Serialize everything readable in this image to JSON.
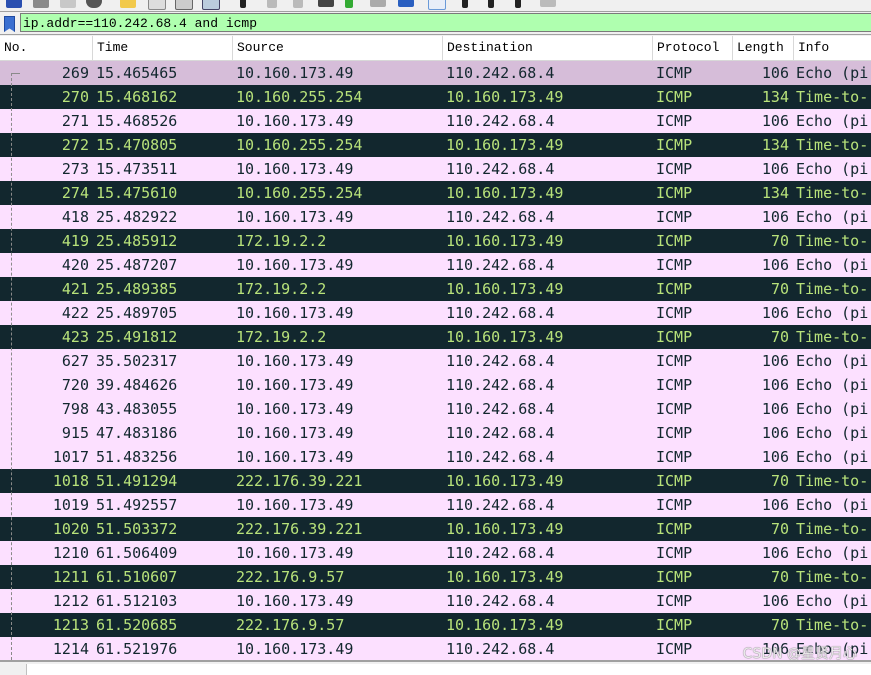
{
  "filter": {
    "value": "ip.addr==110.242.68.4 and icmp"
  },
  "columns": [
    "No.",
    "Time",
    "Source",
    "Destination",
    "Protocol",
    "Length",
    "Info"
  ],
  "rows": [
    {
      "no": "269",
      "time": "15.465465",
      "src": "10.160.173.49",
      "dst": "110.242.68.4",
      "proto": "ICMP",
      "len": "106",
      "info": "Echo (pi",
      "style": "selected"
    },
    {
      "no": "270",
      "time": "15.468162",
      "src": "10.160.255.254",
      "dst": "10.160.173.49",
      "proto": "ICMP",
      "len": "134",
      "info": "Time-to-",
      "style": "dark"
    },
    {
      "no": "271",
      "time": "15.468526",
      "src": "10.160.173.49",
      "dst": "110.242.68.4",
      "proto": "ICMP",
      "len": "106",
      "info": "Echo (pi",
      "style": "light"
    },
    {
      "no": "272",
      "time": "15.470805",
      "src": "10.160.255.254",
      "dst": "10.160.173.49",
      "proto": "ICMP",
      "len": "134",
      "info": "Time-to-",
      "style": "dark"
    },
    {
      "no": "273",
      "time": "15.473511",
      "src": "10.160.173.49",
      "dst": "110.242.68.4",
      "proto": "ICMP",
      "len": "106",
      "info": "Echo (pi",
      "style": "light"
    },
    {
      "no": "274",
      "time": "15.475610",
      "src": "10.160.255.254",
      "dst": "10.160.173.49",
      "proto": "ICMP",
      "len": "134",
      "info": "Time-to-",
      "style": "dark"
    },
    {
      "no": "418",
      "time": "25.482922",
      "src": "10.160.173.49",
      "dst": "110.242.68.4",
      "proto": "ICMP",
      "len": "106",
      "info": "Echo (pi",
      "style": "light"
    },
    {
      "no": "419",
      "time": "25.485912",
      "src": "172.19.2.2",
      "dst": "10.160.173.49",
      "proto": "ICMP",
      "len": "70",
      "info": "Time-to-",
      "style": "dark"
    },
    {
      "no": "420",
      "time": "25.487207",
      "src": "10.160.173.49",
      "dst": "110.242.68.4",
      "proto": "ICMP",
      "len": "106",
      "info": "Echo (pi",
      "style": "light"
    },
    {
      "no": "421",
      "time": "25.489385",
      "src": "172.19.2.2",
      "dst": "10.160.173.49",
      "proto": "ICMP",
      "len": "70",
      "info": "Time-to-",
      "style": "dark"
    },
    {
      "no": "422",
      "time": "25.489705",
      "src": "10.160.173.49",
      "dst": "110.242.68.4",
      "proto": "ICMP",
      "len": "106",
      "info": "Echo (pi",
      "style": "light"
    },
    {
      "no": "423",
      "time": "25.491812",
      "src": "172.19.2.2",
      "dst": "10.160.173.49",
      "proto": "ICMP",
      "len": "70",
      "info": "Time-to-",
      "style": "dark"
    },
    {
      "no": "627",
      "time": "35.502317",
      "src": "10.160.173.49",
      "dst": "110.242.68.4",
      "proto": "ICMP",
      "len": "106",
      "info": "Echo (pi",
      "style": "light"
    },
    {
      "no": "720",
      "time": "39.484626",
      "src": "10.160.173.49",
      "dst": "110.242.68.4",
      "proto": "ICMP",
      "len": "106",
      "info": "Echo (pi",
      "style": "light"
    },
    {
      "no": "798",
      "time": "43.483055",
      "src": "10.160.173.49",
      "dst": "110.242.68.4",
      "proto": "ICMP",
      "len": "106",
      "info": "Echo (pi",
      "style": "light"
    },
    {
      "no": "915",
      "time": "47.483186",
      "src": "10.160.173.49",
      "dst": "110.242.68.4",
      "proto": "ICMP",
      "len": "106",
      "info": "Echo (pi",
      "style": "light"
    },
    {
      "no": "1017",
      "time": "51.483256",
      "src": "10.160.173.49",
      "dst": "110.242.68.4",
      "proto": "ICMP",
      "len": "106",
      "info": "Echo (pi",
      "style": "light"
    },
    {
      "no": "1018",
      "time": "51.491294",
      "src": "222.176.39.221",
      "dst": "10.160.173.49",
      "proto": "ICMP",
      "len": "70",
      "info": "Time-to-",
      "style": "dark"
    },
    {
      "no": "1019",
      "time": "51.492557",
      "src": "10.160.173.49",
      "dst": "110.242.68.4",
      "proto": "ICMP",
      "len": "106",
      "info": "Echo (pi",
      "style": "light"
    },
    {
      "no": "1020",
      "time": "51.503372",
      "src": "222.176.39.221",
      "dst": "10.160.173.49",
      "proto": "ICMP",
      "len": "70",
      "info": "Time-to-",
      "style": "dark"
    },
    {
      "no": "1210",
      "time": "61.506409",
      "src": "10.160.173.49",
      "dst": "110.242.68.4",
      "proto": "ICMP",
      "len": "106",
      "info": "Echo (pi",
      "style": "light"
    },
    {
      "no": "1211",
      "time": "61.510607",
      "src": "222.176.9.57",
      "dst": "10.160.173.49",
      "proto": "ICMP",
      "len": "70",
      "info": "Time-to-",
      "style": "dark"
    },
    {
      "no": "1212",
      "time": "61.512103",
      "src": "10.160.173.49",
      "dst": "110.242.68.4",
      "proto": "ICMP",
      "len": "106",
      "info": "Echo (pi",
      "style": "light"
    },
    {
      "no": "1213",
      "time": "61.520685",
      "src": "222.176.9.57",
      "dst": "10.160.173.49",
      "proto": "ICMP",
      "len": "70",
      "info": "Time-to-",
      "style": "dark"
    },
    {
      "no": "1214",
      "time": "61.521976",
      "src": "10.160.173.49",
      "dst": "110.242.68.4",
      "proto": "ICMP",
      "len": "106",
      "info": "Echo (pi",
      "style": "light"
    }
  ],
  "toolbar_icons": [
    "shark-fin-icon",
    "stop-icon",
    "restart-icon",
    "options-icon",
    "open-file-icon",
    "save-icon",
    "close-file-icon",
    "reload-icon",
    "search-icon",
    "back-icon",
    "forward-icon",
    "jump-icon",
    "first-packet-icon",
    "last-packet-icon",
    "autoscroll-icon",
    "colorize-icon",
    "zoom-in-icon",
    "zoom-out-icon",
    "zoom-normal-icon",
    "resize-columns-icon"
  ],
  "colors": {
    "filter_valid": "#afffaf",
    "row_light": "#fce0ff",
    "row_dark": "#12272e",
    "row_dark_text": "#b8e27a",
    "row_selected": "#d6bdd9"
  },
  "watermark": "CSDN @星贤月心"
}
